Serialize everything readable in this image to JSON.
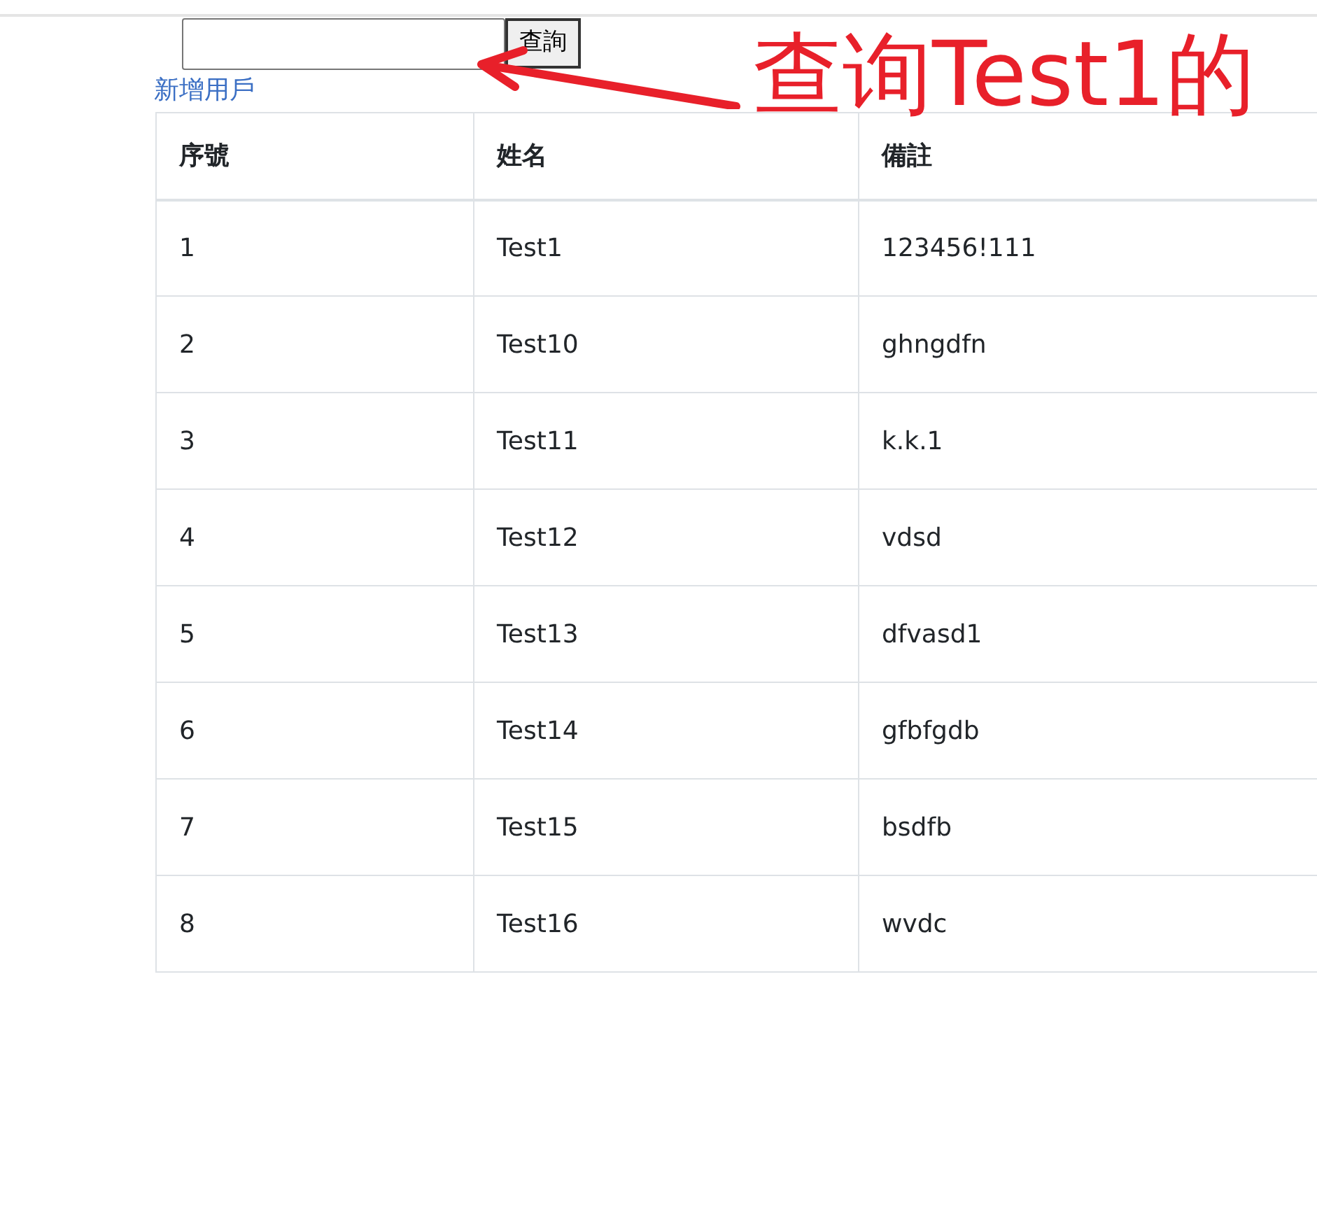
{
  "search": {
    "button": "查詢"
  },
  "add_link": "新增用戶",
  "table": {
    "columns": [
      "序號",
      "姓名",
      "備註"
    ],
    "rows": [
      [
        "1",
        "Test1",
        "123456!111"
      ],
      [
        "2",
        "Test10",
        "ghngdfn"
      ],
      [
        "3",
        "Test11",
        "k.k.1"
      ],
      [
        "4",
        "Test12",
        "vdsd"
      ],
      [
        "5",
        "Test13",
        "dfvasd1"
      ],
      [
        "6",
        "Test14",
        "gfbfgdb"
      ],
      [
        "7",
        "Test15",
        "bsdfb"
      ],
      [
        "8",
        "Test16",
        "wvdc"
      ]
    ]
  },
  "annotation": {
    "text": "查询Test1的"
  }
}
